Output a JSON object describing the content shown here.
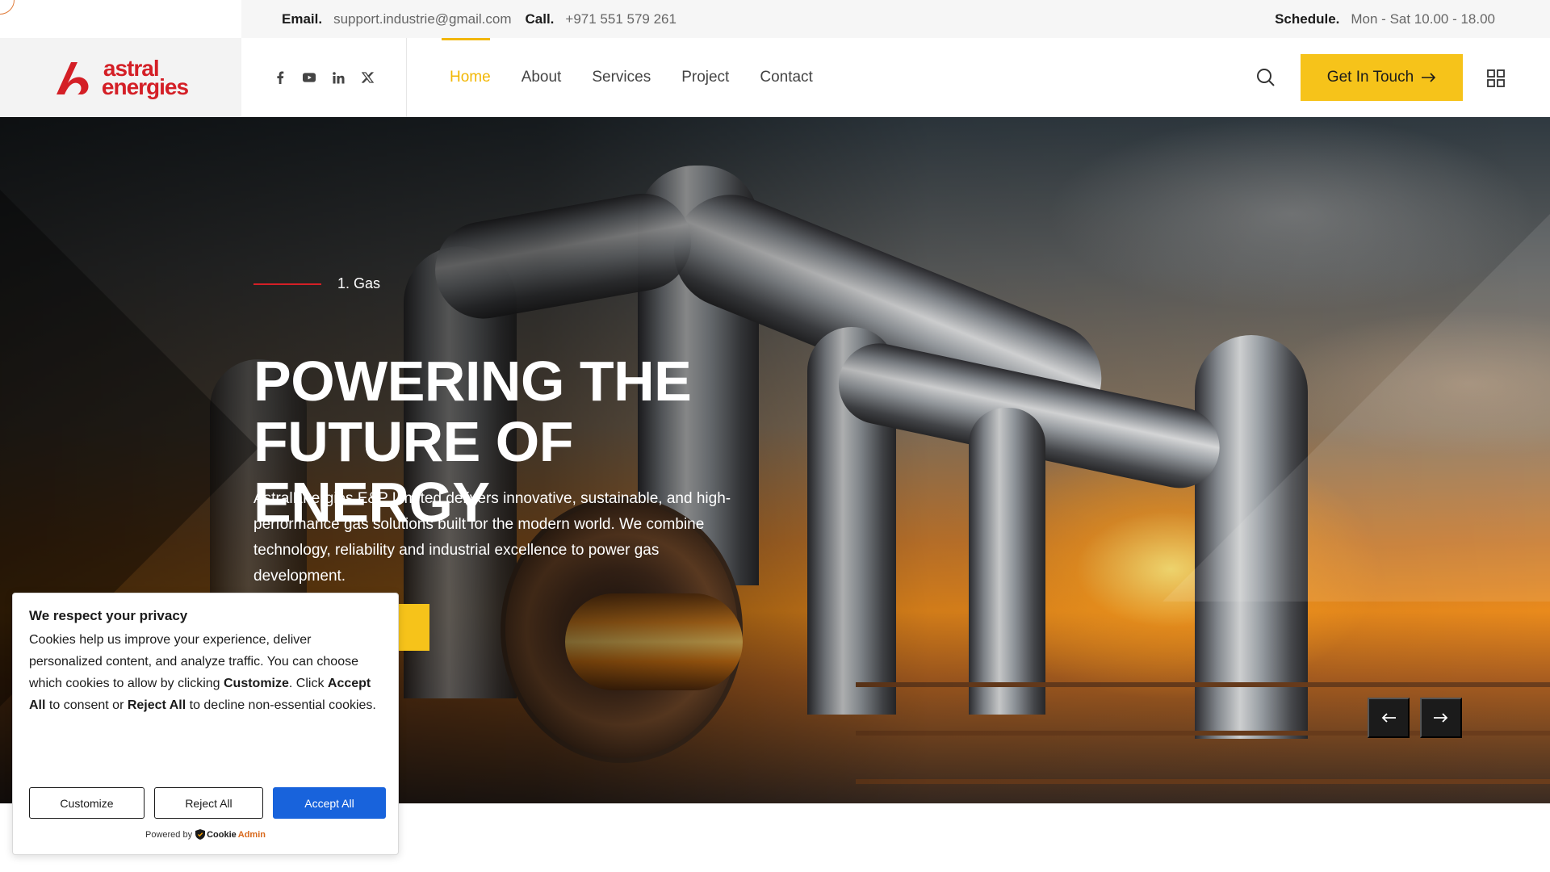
{
  "topbar": {
    "email_label": "Email.",
    "email_value": "support.industrie@gmail.com",
    "call_label": "Call.",
    "call_value": "+971 551 579 261",
    "schedule_label": "Schedule.",
    "schedule_value": "Mon - Sat 10.00 - 18.00"
  },
  "logo": {
    "line1": "astral",
    "line2": "energies",
    "color": "#d41f26"
  },
  "socials": [
    {
      "icon": "facebook-icon"
    },
    {
      "icon": "youtube-icon"
    },
    {
      "icon": "linkedin-icon"
    },
    {
      "icon": "x-twitter-icon"
    }
  ],
  "nav": {
    "items": [
      {
        "label": "Home",
        "active": true
      },
      {
        "label": "About"
      },
      {
        "label": "Services"
      },
      {
        "label": "Project"
      },
      {
        "label": "Contact"
      }
    ]
  },
  "header": {
    "cta_label": "Get In Touch",
    "accent": "#f6c31a"
  },
  "hero": {
    "eyebrow": "1. Gas",
    "headline_line1": "POWERING THE",
    "headline_line2": "FUTURE OF ENERGY",
    "lead": "AstralEnergies E&P Limited delivers innovative, sustainable, and high-performance gas solutions built for the modern world. We combine technology, reliability and industrial excellence to power gas development."
  },
  "cookie": {
    "title": "We respect your privacy",
    "text_1": "Cookies help us improve your experience, deliver personalized content, and analyze traffic. You can choose which cookies to allow by clicking ",
    "text_customize": "Customize",
    "text_2": ". Click ",
    "text_accept": "Accept All",
    "text_3": " to consent or ",
    "text_reject": "Reject All",
    "text_4": " to decline non-essential cookies.",
    "btn_customize": "Customize",
    "btn_reject": "Reject All",
    "btn_accept": "Accept All",
    "powered_by": "Powered by",
    "brand_a": "Cookie",
    "brand_b": "Admin",
    "primary_color": "#1863dc"
  }
}
